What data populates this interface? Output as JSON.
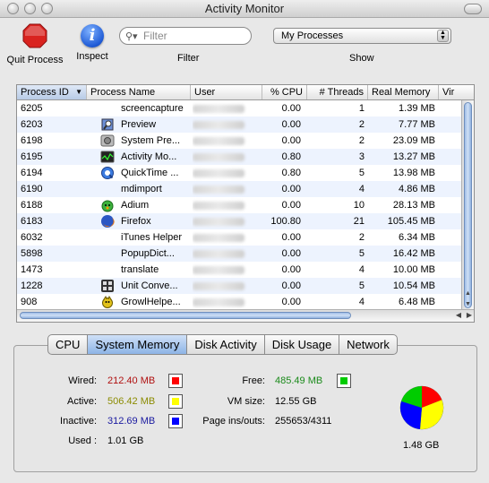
{
  "window": {
    "title": "Activity Monitor"
  },
  "toolbar": {
    "quit_label": "Quit Process",
    "inspect_label": "Inspect",
    "filter_label": "Filter",
    "filter_placeholder": "Filter",
    "show_label": "Show",
    "show_value": "My Processes"
  },
  "table": {
    "headers": [
      "Process ID",
      "Process Name",
      "User",
      "% CPU",
      "# Threads",
      "Real Memory",
      "Vir"
    ],
    "sort_column": "Process ID",
    "rows": [
      {
        "pid": "6205",
        "name": "screencapture",
        "icon": "none",
        "cpu": "0.00",
        "threads": "1",
        "mem": "1.39 MB"
      },
      {
        "pid": "6203",
        "name": "Preview",
        "icon": "preview-icon",
        "cpu": "0.00",
        "threads": "2",
        "mem": "7.77 MB"
      },
      {
        "pid": "6198",
        "name": "System Pre...",
        "icon": "system-preferences-icon",
        "cpu": "0.00",
        "threads": "2",
        "mem": "23.09 MB"
      },
      {
        "pid": "6195",
        "name": "Activity Mo...",
        "icon": "activity-monitor-icon",
        "cpu": "0.80",
        "threads": "3",
        "mem": "13.27 MB"
      },
      {
        "pid": "6194",
        "name": "QuickTime ...",
        "icon": "quicktime-icon",
        "cpu": "0.80",
        "threads": "5",
        "mem": "13.98 MB"
      },
      {
        "pid": "6190",
        "name": "mdimport",
        "icon": "none",
        "cpu": "0.00",
        "threads": "4",
        "mem": "4.86 MB"
      },
      {
        "pid": "6188",
        "name": "Adium",
        "icon": "adium-icon",
        "cpu": "0.00",
        "threads": "10",
        "mem": "28.13 MB"
      },
      {
        "pid": "6183",
        "name": "Firefox",
        "icon": "firefox-icon",
        "cpu": "100.80",
        "threads": "21",
        "mem": "105.45 MB"
      },
      {
        "pid": "6032",
        "name": "iTunes Helper",
        "icon": "none",
        "cpu": "0.00",
        "threads": "2",
        "mem": "6.34 MB"
      },
      {
        "pid": "5898",
        "name": "PopupDict...",
        "icon": "none",
        "cpu": "0.00",
        "threads": "5",
        "mem": "16.42 MB"
      },
      {
        "pid": "1473",
        "name": "translate",
        "icon": "none",
        "cpu": "0.00",
        "threads": "4",
        "mem": "10.00 MB"
      },
      {
        "pid": "1228",
        "name": "Unit Conve...",
        "icon": "unit-converter-icon",
        "cpu": "0.00",
        "threads": "5",
        "mem": "10.54 MB"
      },
      {
        "pid": "908",
        "name": "GrowlHelpe...",
        "icon": "growl-icon",
        "cpu": "0.00",
        "threads": "4",
        "mem": "6.48 MB"
      }
    ]
  },
  "tabs": [
    "CPU",
    "System Memory",
    "Disk Activity",
    "Disk Usage",
    "Network"
  ],
  "selected_tab": "System Memory",
  "memory": {
    "wired_label": "Wired:",
    "wired_value": "212.40 MB",
    "wired_color": "#ff0000",
    "active_label": "Active:",
    "active_value": "506.42 MB",
    "active_color": "#ffff00",
    "inactive_label": "Inactive:",
    "inactive_value": "312.69 MB",
    "inactive_color": "#0000ff",
    "used_label": "Used :",
    "used_value": "1.01 GB",
    "free_label": "Free:",
    "free_value": "485.49 MB",
    "free_color": "#00cc00",
    "vmsize_label": "VM size:",
    "vmsize_value": "12.55 GB",
    "pageins_label": "Page ins/outs:",
    "pageins_value": "255653/4311",
    "total_value": "1.48 GB"
  }
}
